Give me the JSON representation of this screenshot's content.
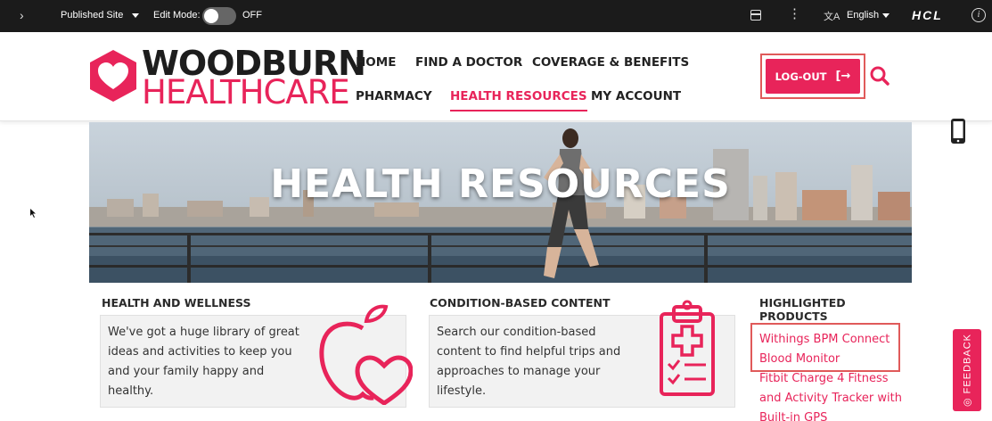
{
  "toolbar": {
    "expand_glyph": "›",
    "site_label": "Published Site",
    "edit_mode_label": "Edit Mode:",
    "edit_mode_state": "OFF",
    "language": "English",
    "brand": "HCL",
    "translate_glyph": "文A",
    "dots_glyph": "⋮",
    "info_glyph": "i"
  },
  "logo": {
    "line1": "WOODBURN",
    "line2": "HEALTHCARE"
  },
  "nav": {
    "items": [
      {
        "label": "HOME",
        "active": false
      },
      {
        "label": "FIND A DOCTOR",
        "active": false
      },
      {
        "label": "COVERAGE & BENEFITS",
        "active": false
      },
      {
        "label": "PHARMACY",
        "active": false
      },
      {
        "label": "HEALTH RESOURCES",
        "active": true
      },
      {
        "label": "MY ACCOUNT",
        "active": false
      }
    ]
  },
  "logout": {
    "label": "LOG-OUT",
    "arrow": "[→"
  },
  "hero": {
    "title": "HEALTH RESOURCES"
  },
  "sections": {
    "wellness": {
      "heading": "HEALTH AND WELLNESS",
      "lines": [
        "We've got a huge library of great",
        "ideas and activities to keep you",
        "and your family happy and",
        "healthy."
      ]
    },
    "condition": {
      "heading": "CONDITION-BASED CONTENT",
      "lines": [
        "Search our condition-based",
        "content to find helpful trips and",
        "approaches to manage your",
        "lifestyle."
      ]
    },
    "highlighted": {
      "heading_line1": "HIGHLIGHTED",
      "heading_line2": "PRODUCTS",
      "products": [
        {
          "lines": [
            "Withings BPM Connect",
            "Blood Monitor"
          ]
        },
        {
          "lines": [
            "Fitbit Charge 4 Fitness",
            "and Activity Tracker with",
            "Built-in GPS"
          ]
        }
      ]
    }
  },
  "feedback": {
    "label": "FEEDBACK"
  },
  "colors": {
    "accent": "#e8245a",
    "toolbar_bg": "#1b1b1b",
    "highlight_border": "#e05a5a"
  },
  "icons": [
    "chevron-right-icon",
    "caret-down-icon",
    "layout-icon",
    "more-vertical-icon",
    "translate-icon",
    "info-icon",
    "search-icon",
    "logout-icon",
    "mobile-preview-icon",
    "apple-heart-icon",
    "clipboard-medical-icon",
    "feedback-icon"
  ]
}
